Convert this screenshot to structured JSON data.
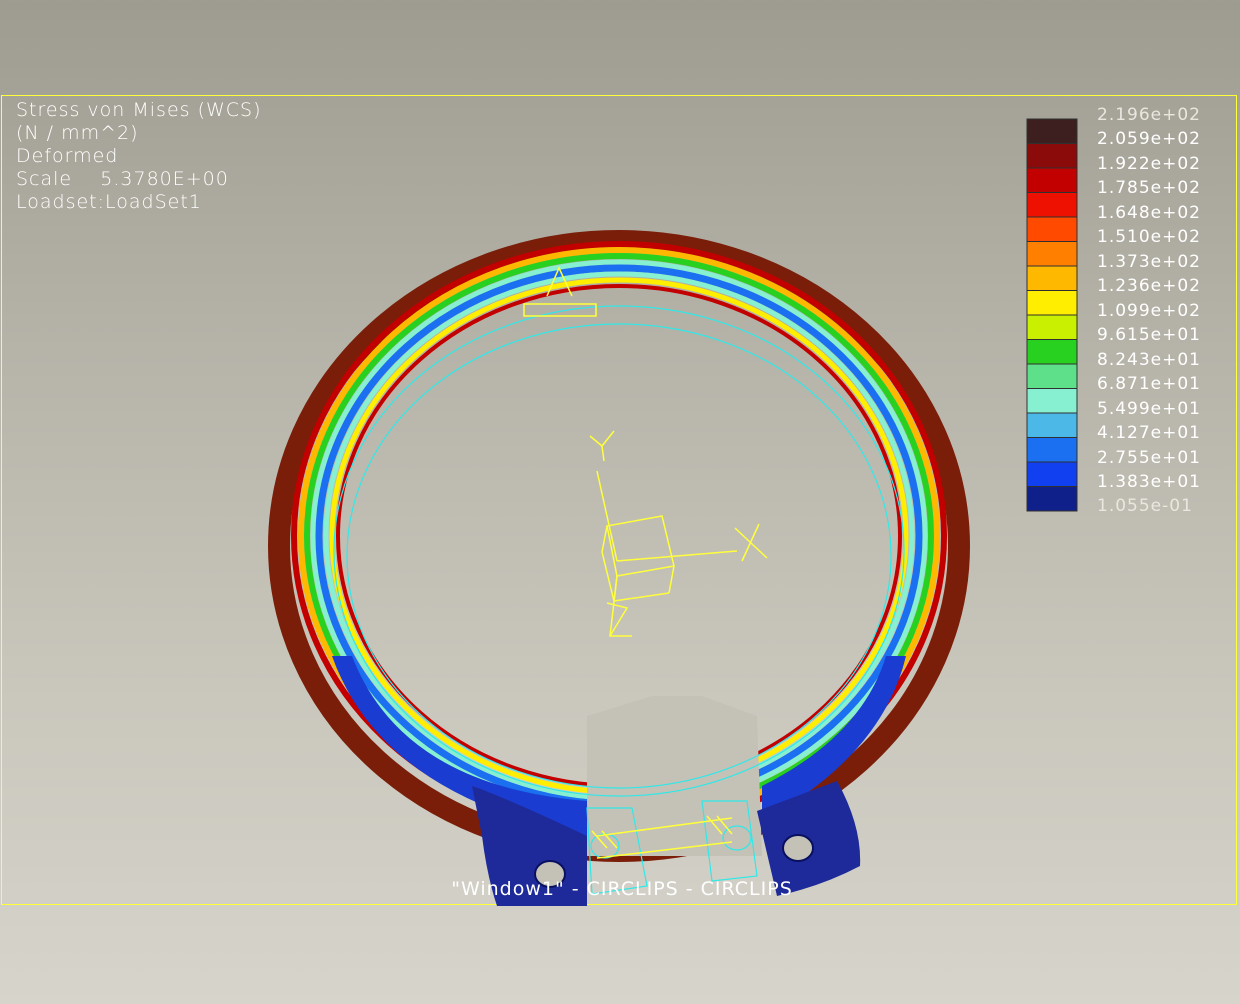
{
  "info": {
    "line1": "Stress von Mises (WCS)",
    "line2": "(N / mm^2)",
    "line3": "Deformed",
    "line4": "Scale    5.3780E+00",
    "line5": "Loadset:LoadSet1"
  },
  "legend": {
    "top_value": "2.196e+02",
    "bottom_value": "1.055e-01",
    "labels": [
      "2.059e+02",
      "1.922e+02",
      "1.785e+02",
      "1.648e+02",
      "1.510e+02",
      "1.373e+02",
      "1.236e+02",
      "1.099e+02",
      "9.615e+01",
      "8.243e+01",
      "6.871e+01",
      "5.499e+01",
      "4.127e+01",
      "2.755e+01",
      "1.383e+01"
    ],
    "colors": [
      "#3c1f1e",
      "#8b0a0a",
      "#c20000",
      "#ee1000",
      "#ff4a00",
      "#ff8000",
      "#ffb800",
      "#ffee00",
      "#c8f000",
      "#28d020",
      "#5ee08a",
      "#86f0d0",
      "#4cb8e8",
      "#1a70f0",
      "#1040f0",
      "#10208a"
    ]
  },
  "axes": {
    "x": "X",
    "y": "Y",
    "z": "Z"
  },
  "footer": "\"Window1\" - CIRCLIPS - CIRCLIPS",
  "colors": {
    "frame": "#ffff3a",
    "wireframe": "#30e8e8",
    "triad": "#ffff3a"
  }
}
